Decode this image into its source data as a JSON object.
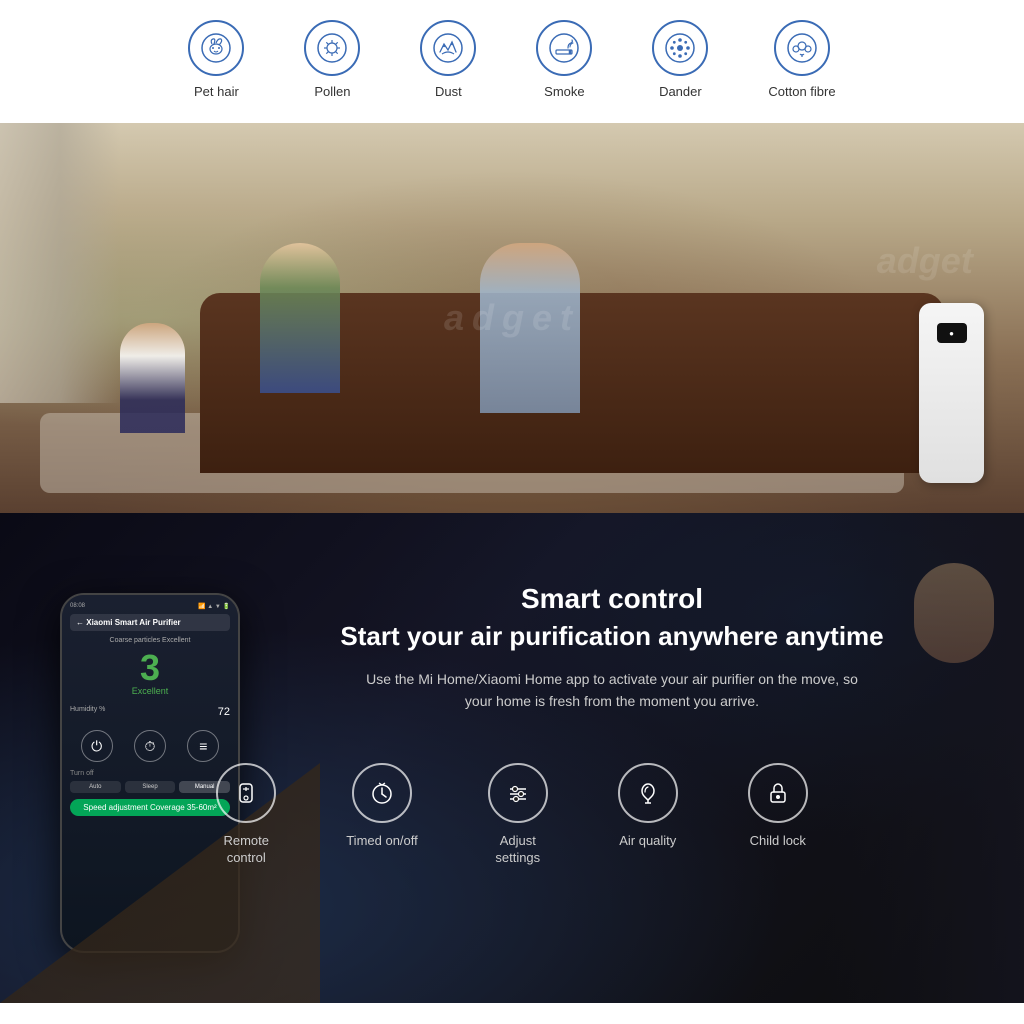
{
  "features_top": {
    "items": [
      {
        "id": "pet-hair",
        "label": "Pet hair",
        "icon": "🐱"
      },
      {
        "id": "pollen",
        "label": "Pollen",
        "icon": "🌸"
      },
      {
        "id": "dust",
        "label": "Dust",
        "icon": "💨"
      },
      {
        "id": "smoke",
        "label": "Smoke",
        "icon": "🚬"
      },
      {
        "id": "dander",
        "label": "Dander",
        "icon": "✦"
      },
      {
        "id": "cotton-fibre",
        "label": "Cotton fibre",
        "icon": "☁"
      }
    ]
  },
  "smart_section": {
    "title": "Smart control",
    "subtitle": "Start your air purification anywhere anytime",
    "description": "Use the Mi Home/Xiaomi Home app to activate your air purifier on the move, so your home is fresh from the moment you arrive.",
    "features": [
      {
        "id": "remote-control",
        "label": "Remote\ncontrol",
        "icon": "🏠"
      },
      {
        "id": "timed-onoff",
        "label": "Timed on/off",
        "icon": "⏰"
      },
      {
        "id": "adjust-settings",
        "label": "Adjust\nsettings",
        "icon": "⚙"
      },
      {
        "id": "air-quality",
        "label": "Air quality",
        "icon": "🍃"
      },
      {
        "id": "child-lock",
        "label": "Child lock",
        "icon": "🔒"
      }
    ]
  },
  "phone": {
    "header": "Xiaomi Smart Air Purifier",
    "aqi_value": "3",
    "aqi_label": "Coarse particles Excellent",
    "aqi_status": "Excellent",
    "humidity": "72",
    "humidity_label": "Humidity %",
    "speed_label": "Speed adjustment   Coverage 35-60m²"
  },
  "watermark": "adget"
}
